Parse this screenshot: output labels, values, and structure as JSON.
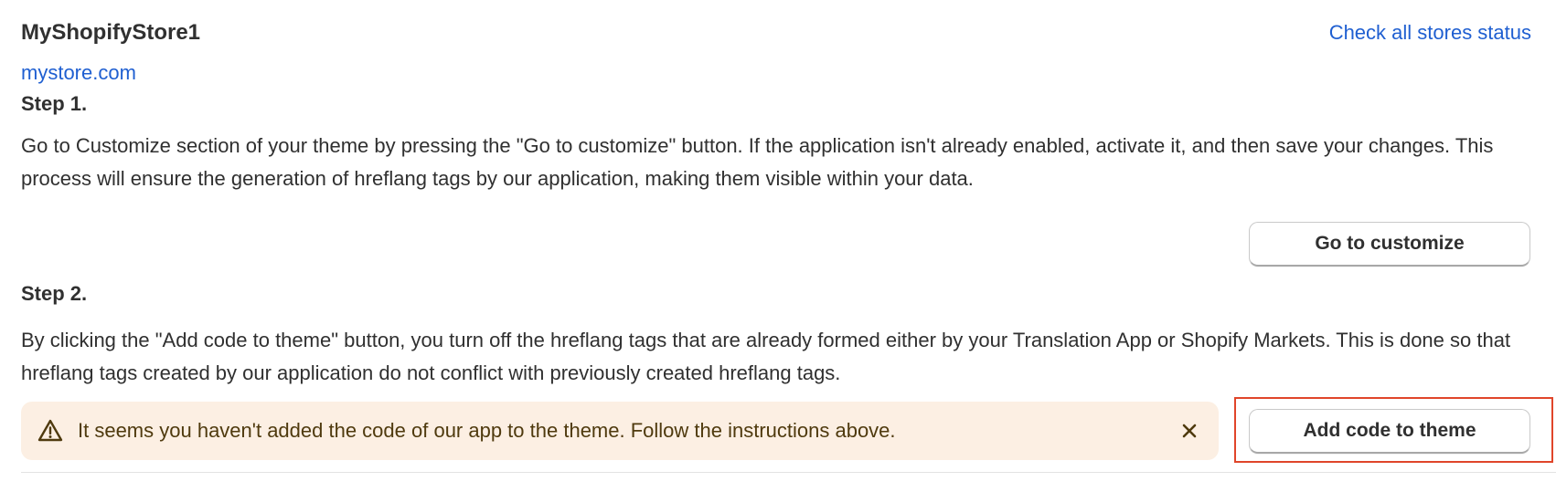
{
  "store": {
    "name": "MyShopifyStore1",
    "url": "mystore.com",
    "check_all_link": "Check all stores status"
  },
  "step1": {
    "heading": "Step 1.",
    "description": "Go to Customize section of your theme by pressing the \"Go to customize\" button. If the application isn't already enabled, activate it, and then save your changes. This process will ensure the generation of hreflang tags by our application, making them visible within your data.",
    "button_label": "Go to customize"
  },
  "step2": {
    "heading": "Step 2.",
    "description": "By clicking the \"Add code to theme\" button, you turn off the hreflang tags that are already formed either by your Translation App or Shopify Markets. This is done so that hreflang tags created by our application do not conflict with previously created hreflang tags.",
    "button_label": "Add code to theme"
  },
  "warning_banner": {
    "icon": "alert-triangle-icon",
    "message": "It seems you haven't added the code of our app to the theme. Follow the instructions above.",
    "close_icon": "close-icon",
    "background_color": "#fcefe3",
    "text_color": "#4f3a0e"
  },
  "colors": {
    "link": "#1f5fd1",
    "highlight": "#e0452a"
  }
}
